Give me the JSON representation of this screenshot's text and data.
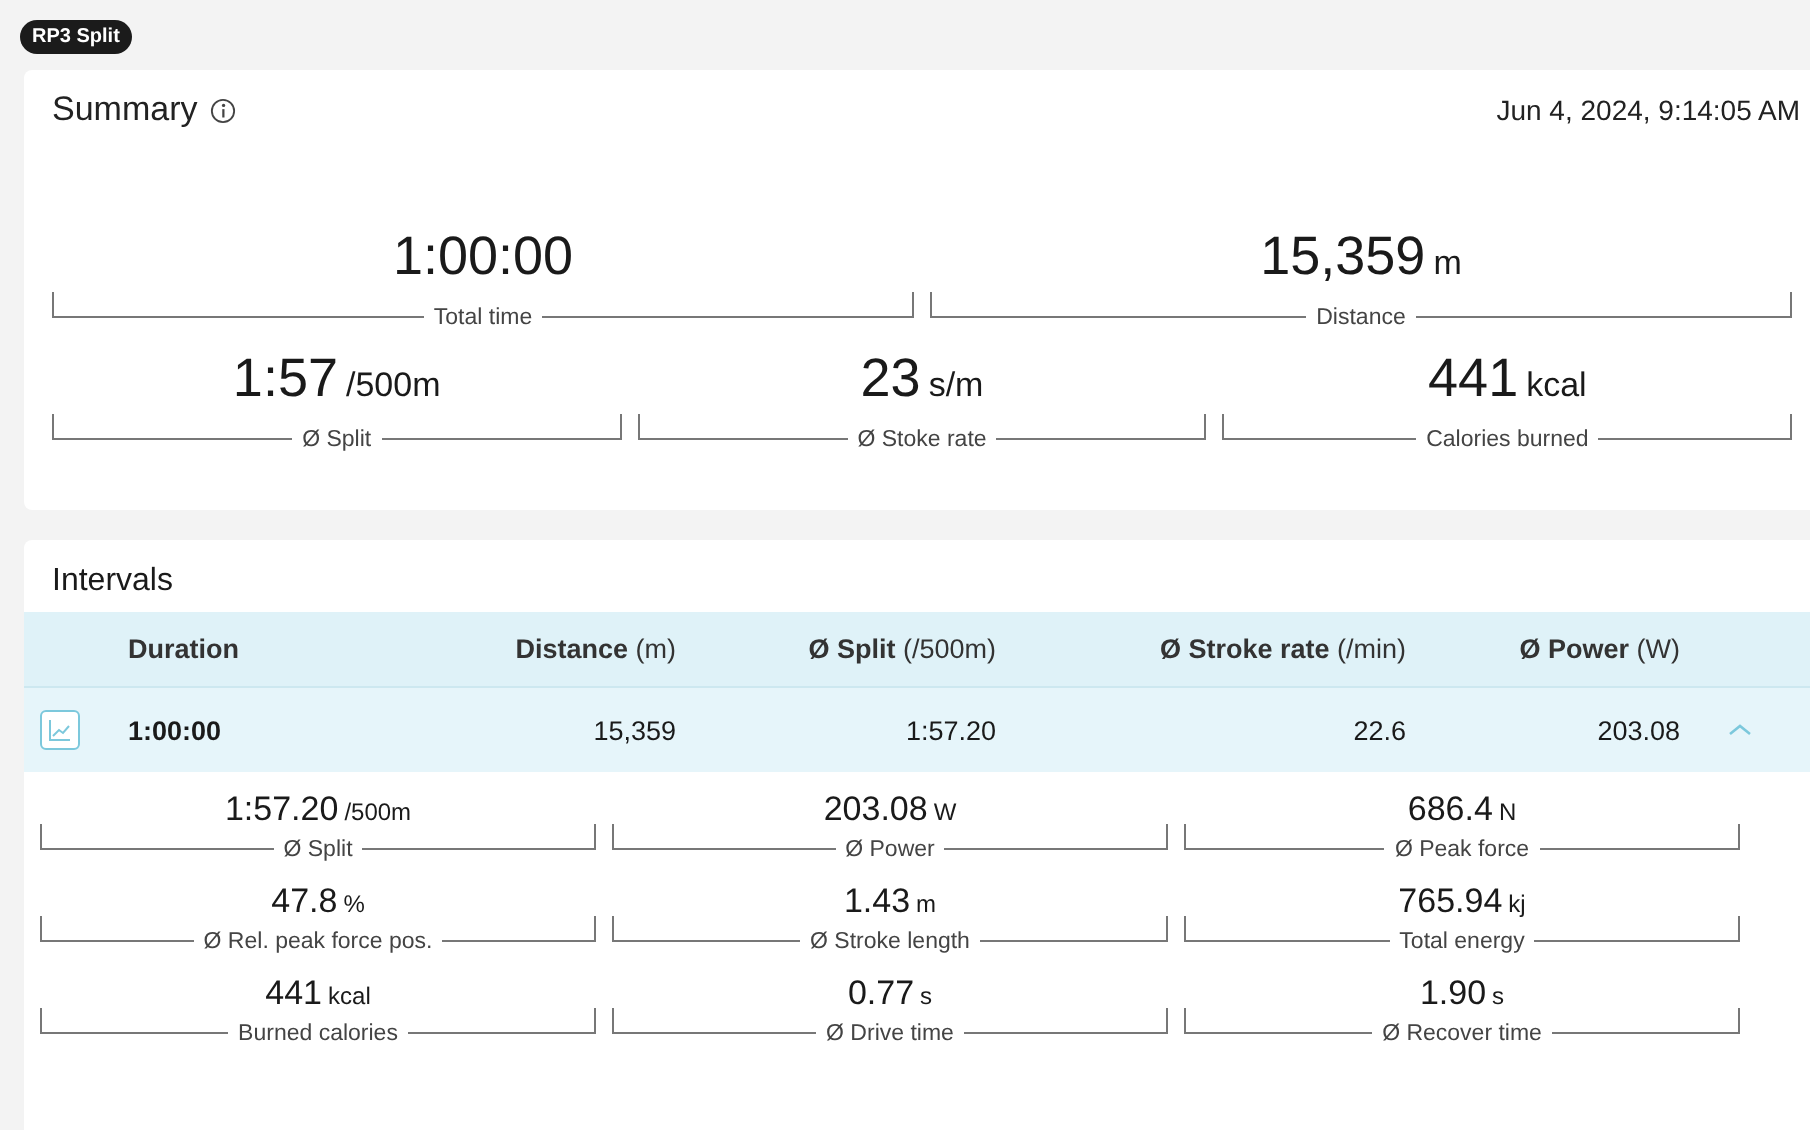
{
  "badge": "RP3 Split",
  "summary": {
    "title": "Summary",
    "date": "Jun 4, 2024, 9:14:05 AM",
    "rows": [
      [
        {
          "value": "1:00:00",
          "label": "Total time"
        },
        {
          "value": "15,359",
          "unit": "m",
          "label": "Distance"
        }
      ],
      [
        {
          "value": "1:57",
          "unit": "/500m",
          "label": "Ø Split"
        },
        {
          "value": "23",
          "unit": "s/m",
          "label": "Ø Stoke rate"
        },
        {
          "value": "441",
          "unit": "kcal",
          "label": "Calories burned"
        }
      ]
    ]
  },
  "intervals": {
    "title": "Intervals",
    "columns": [
      "**Duration**",
      "**Distance** (m)",
      "**Ø Split** (/500m)",
      "**Ø Stroke rate** (/min)",
      "**Ø Power** (W)"
    ],
    "rows": [
      {
        "cells": [
          "1:00:00",
          "15,359",
          "1:57.20",
          "22.6",
          "203.08"
        ],
        "expanded": true,
        "details": [
          {
            "value": "1:57.20",
            "unit": "/500m",
            "label": "Ø Split"
          },
          {
            "value": "203.08",
            "unit": "W",
            "label": "Ø Power"
          },
          {
            "value": "686.4",
            "unit": "N",
            "label": "Ø Peak force"
          },
          {
            "value": "47.8",
            "unit": "%",
            "label": "Ø Rel. peak force pos."
          },
          {
            "value": "1.43",
            "unit": "m",
            "label": "Ø Stroke length"
          },
          {
            "value": "765.94",
            "unit": "kj",
            "label": "Total energy"
          },
          {
            "value": "441",
            "unit": "kcal",
            "label": "Burned calories"
          },
          {
            "value": "0.77",
            "unit": "s",
            "label": "Ø Drive time"
          },
          {
            "value": "1.90",
            "unit": "s",
            "label": "Ø Recover time"
          }
        ]
      }
    ]
  }
}
